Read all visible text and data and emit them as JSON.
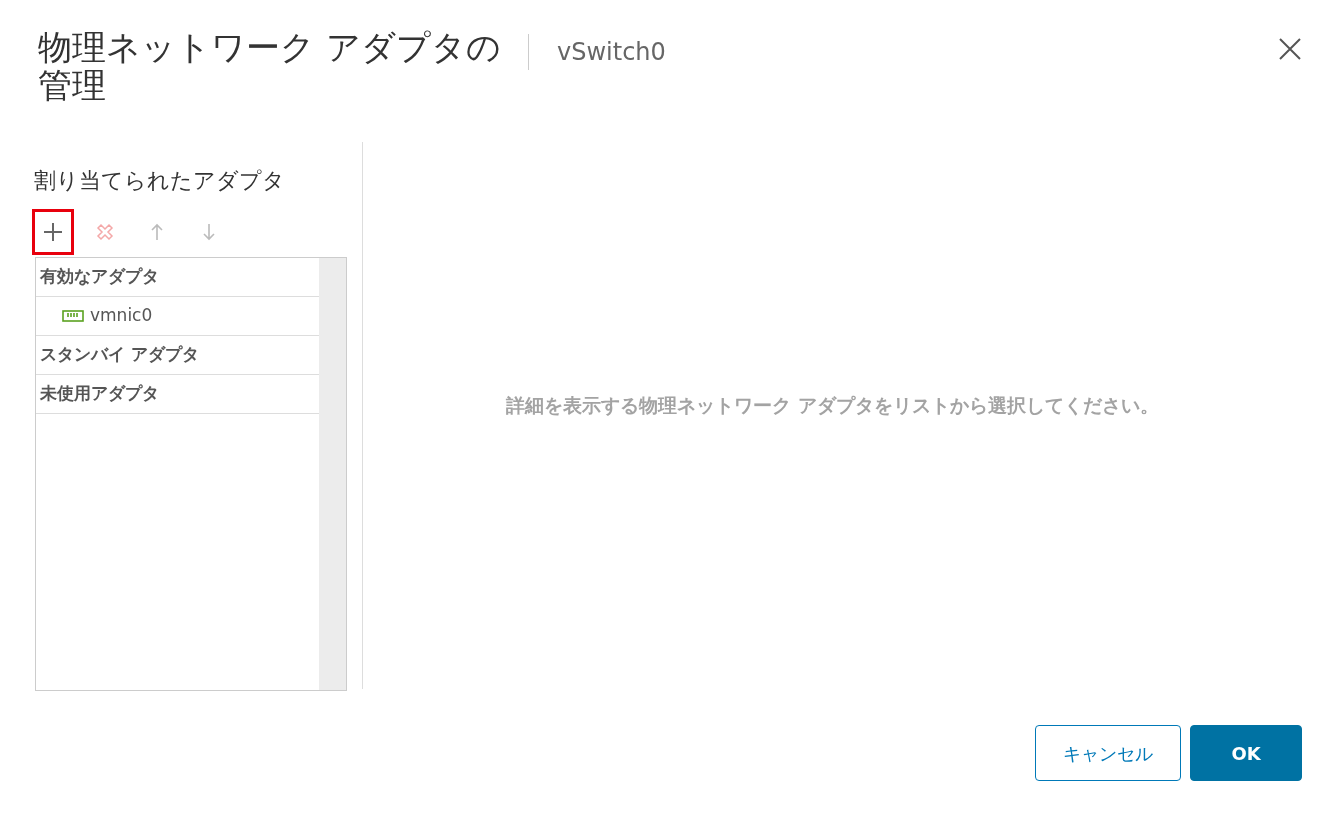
{
  "dialog": {
    "title": "物理ネットワーク アダプタの管理",
    "subtitle": "vSwitch0"
  },
  "left_panel": {
    "heading": "割り当てられたアダプタ",
    "toolbar": [
      {
        "kind": "add",
        "disabled": false,
        "highlighted": true
      },
      {
        "kind": "remove",
        "disabled": true,
        "highlighted": false
      },
      {
        "kind": "up",
        "disabled": true,
        "highlighted": false
      },
      {
        "kind": "down",
        "disabled": true,
        "highlighted": false
      }
    ],
    "groups": [
      {
        "label": "有効なアダプタ",
        "children": [
          {
            "label": "vmnic0",
            "selected": false
          }
        ]
      },
      {
        "label": "スタンバイ アダプタ"
      },
      {
        "label": "未使用アダプタ"
      }
    ]
  },
  "detail_message": "詳細を表示する物理ネットワーク アダプタをリストから選択してください。",
  "buttons": [
    {
      "label": "キャンセル",
      "kind": "secondary"
    },
    {
      "label": "OK",
      "kind": "primary"
    }
  ]
}
